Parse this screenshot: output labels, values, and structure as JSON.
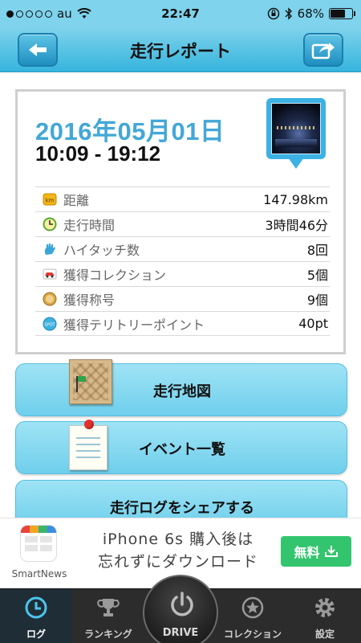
{
  "status_bar": {
    "carrier": "au",
    "time": "22:47",
    "battery": "68%",
    "battery_level": 0.68
  },
  "nav": {
    "title": "走行レポート",
    "back_icon": "back-arrow-icon",
    "share_icon": "share-icon"
  },
  "report": {
    "date": "2016年05月01日",
    "time_range": "10:09 - 19:12",
    "stats": [
      {
        "icon": "km-icon",
        "label": "距離",
        "value": "147.98km"
      },
      {
        "icon": "clock-icon",
        "label": "走行時間",
        "value": "3時間46分"
      },
      {
        "icon": "high-five-icon",
        "label": "ハイタッチ数",
        "value": "8回"
      },
      {
        "icon": "car-collection-icon",
        "label": "獲得コレクション",
        "value": "5個"
      },
      {
        "icon": "medal-icon",
        "label": "獲得称号",
        "value": "9個"
      },
      {
        "icon": "spot-icon",
        "label": "獲得テリトリーポイント",
        "value": "40pt"
      }
    ]
  },
  "actions": {
    "map_label": "走行地図",
    "events_label": "イベント一覧",
    "share_label": "走行ログをシェアする"
  },
  "ad": {
    "brand": "SmartNews",
    "text_line1": "iPhone 6s 購入後は",
    "text_line2": "忘れずにダウンロード",
    "cta": "無料"
  },
  "tabs": {
    "log": "ログ",
    "ranking": "ランキング",
    "drive": "DRIVE",
    "collection": "コレクション",
    "settings": "設定"
  },
  "colors": {
    "accent": "#43a7d7",
    "nav_bg": "#4bbfe3",
    "button_bg": "#8fdcf2",
    "ad_cta": "#33c56e",
    "tab_bar": "#2c2c2c"
  }
}
